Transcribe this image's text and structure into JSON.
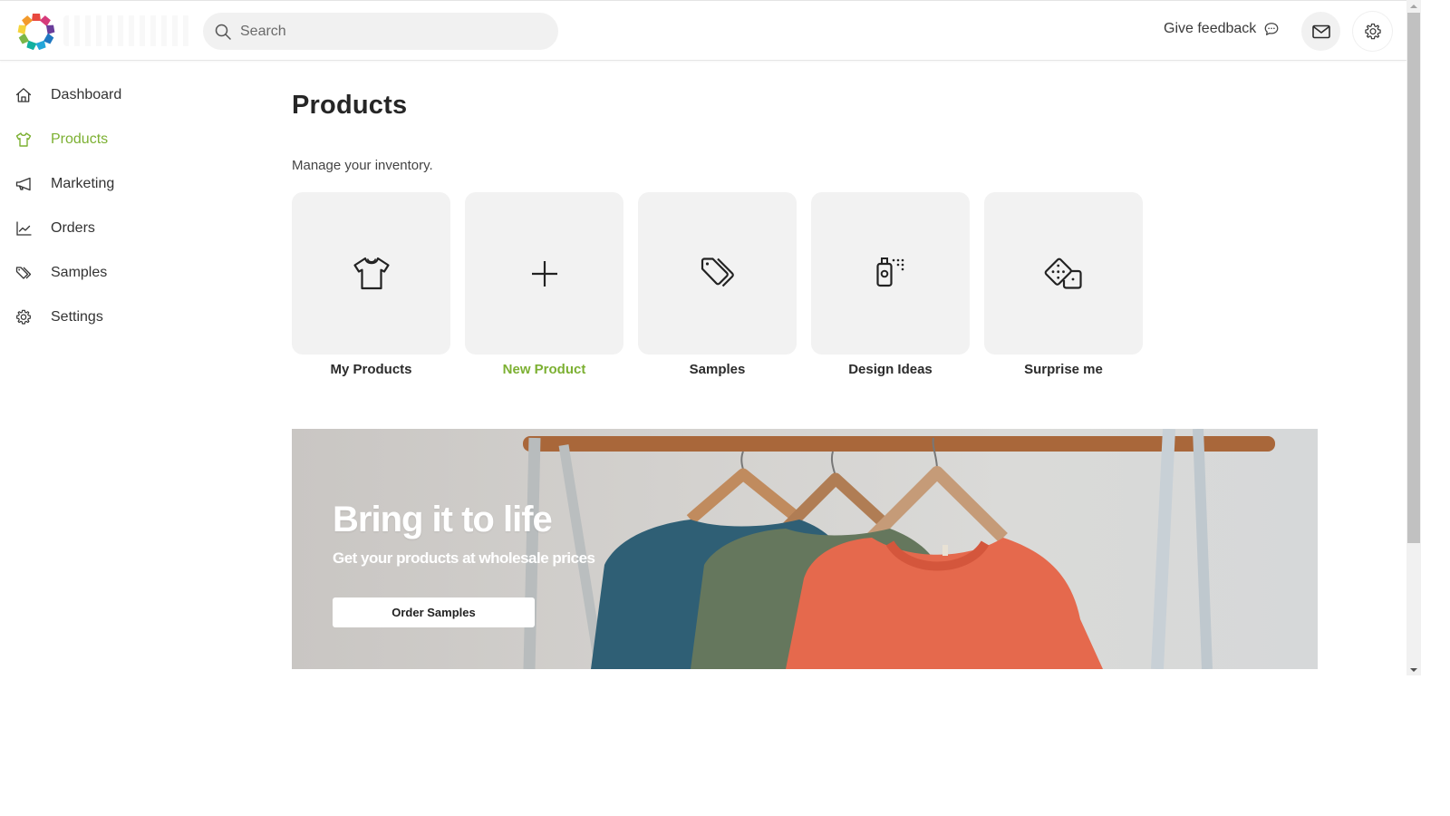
{
  "header": {
    "logo_name": "brand-logo",
    "search": {
      "placeholder": "Search",
      "value": ""
    },
    "feedback_label": "Give feedback",
    "icons": {
      "feedback": "chat-bubble-icon",
      "mail": "envelope-icon",
      "settings": "gear-icon"
    }
  },
  "sidebar": {
    "items": [
      {
        "label": "Dashboard",
        "icon": "home-icon",
        "active": false
      },
      {
        "label": "Products",
        "icon": "tshirt-icon",
        "active": true
      },
      {
        "label": "Marketing",
        "icon": "megaphone-icon",
        "active": false
      },
      {
        "label": "Orders",
        "icon": "line-chart-icon",
        "active": false
      },
      {
        "label": "Samples",
        "icon": "tags-icon",
        "active": false
      },
      {
        "label": "Settings",
        "icon": "gear-icon",
        "active": false
      }
    ]
  },
  "main": {
    "title": "Products",
    "subtitle": "Manage your inventory.",
    "tiles": [
      {
        "label": "My Products",
        "icon": "tshirt-icon",
        "highlighted": false
      },
      {
        "label": "New Product",
        "icon": "plus-icon",
        "highlighted": true
      },
      {
        "label": "Samples",
        "icon": "tags-icon",
        "highlighted": false
      },
      {
        "label": "Design Ideas",
        "icon": "spray-bottle-icon",
        "highlighted": false
      },
      {
        "label": "Surprise me",
        "icon": "dice-icon",
        "highlighted": false
      }
    ],
    "banner": {
      "title": "Bring it to life",
      "subtitle": "Get your products at wholesale prices",
      "button_label": "Order Samples"
    }
  },
  "colors": {
    "accent": "#7cb032",
    "tile_background": "#f2f2f2",
    "search_background": "#f1f1f1",
    "text_primary": "#2b2b2b"
  }
}
